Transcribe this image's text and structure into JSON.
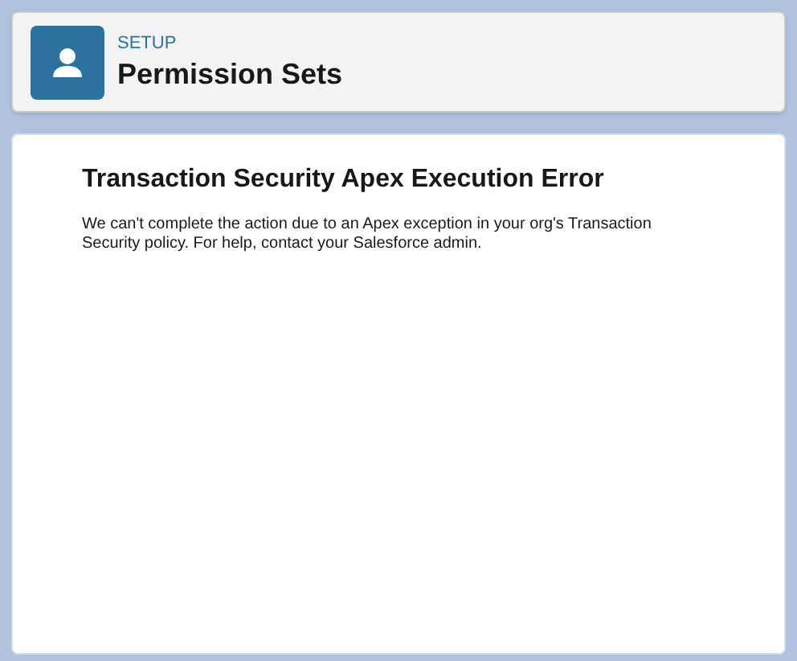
{
  "header": {
    "breadcrumb": "SETUP",
    "title": "Permission Sets"
  },
  "error": {
    "title": "Transaction Security Apex Execution Error",
    "message": "We can't complete the action due to an Apex exception in your org's Transaction Security policy. For help, contact your Salesforce admin."
  }
}
